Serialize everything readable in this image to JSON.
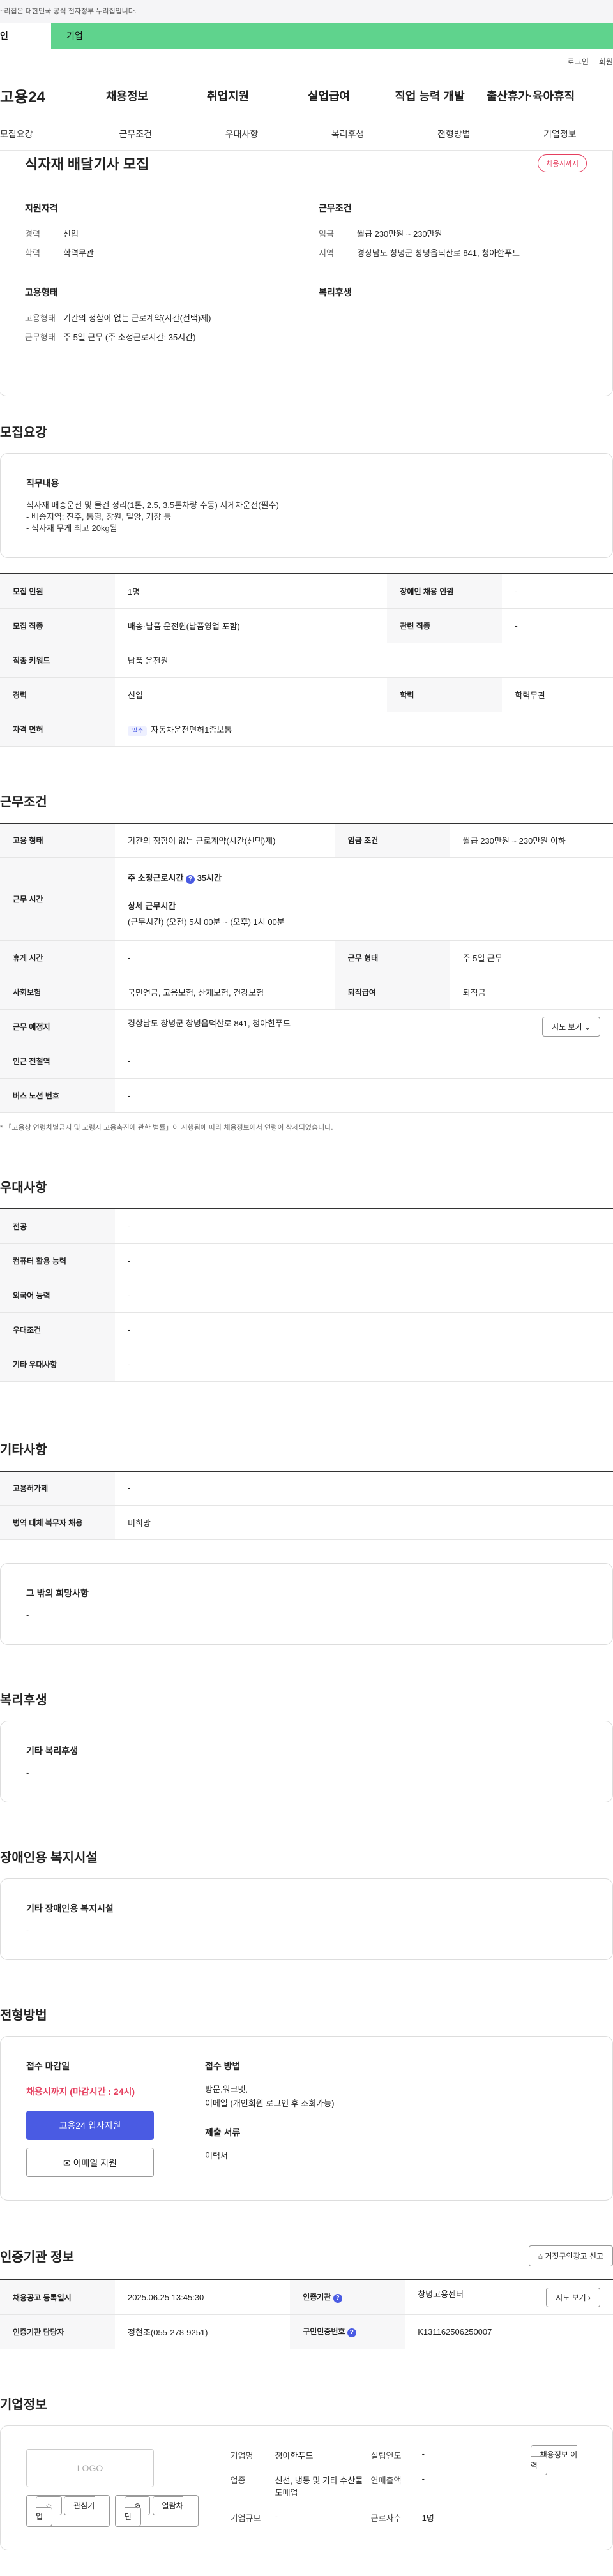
{
  "gov_notice": "~리집은 대한민국 공식 전자정부 누리집입니다.",
  "tabs": {
    "person": "인",
    "company": "기업"
  },
  "util": {
    "login": "로그인",
    "join": "회원"
  },
  "logo": "고용24",
  "gnb": [
    "채용정보",
    "취업지원",
    "실업급여",
    "직업 능력 개발",
    "출산휴가·육아휴직"
  ],
  "lnb": [
    "모집요강",
    "근무조건",
    "우대사항",
    "복리후생",
    "전형방법",
    "기업정보"
  ],
  "job": {
    "title": "식자재 배달기사 모집",
    "badge": "채용시까지",
    "qual_head": "지원자격",
    "qual": [
      {
        "k": "경력",
        "v": "신입"
      },
      {
        "k": "학력",
        "v": "학력무관"
      }
    ],
    "cond_head": "근무조건",
    "cond": [
      {
        "k": "임금",
        "v": "월급 230만원 ~ 230만원"
      },
      {
        "k": "지역",
        "v": "경상남도 창녕군 창녕읍덕산로 841, 청아한푸드"
      }
    ],
    "emp_head": "고용형태",
    "emp": [
      {
        "k": "고용형태",
        "v": "기간의 정함이 없는 근로계약(시간(선택)제)"
      },
      {
        "k": "근무형태",
        "v": "주 5일 근무 (주 소정근로시간: 35시간)"
      }
    ],
    "welfare_head": "복리후생"
  },
  "recruit": {
    "section_title": "모집요강",
    "duty_title": "직무내용",
    "duty_lines": [
      "식자재 배송운전 및 물건 정리(1톤, 2.5, 3.5톤차량 수동) 지게차운전(필수)",
      "- 배송지역: 진주, 통영, 창원, 밀양, 거창 등",
      "- 식자재 무게 최고 20kg됨"
    ],
    "rows": [
      [
        "모집 인원",
        "1명",
        "장애인 채용 인원",
        "-"
      ],
      [
        "모집 직종",
        "배송·납품 운전원(납품영업 포함)",
        "관련 직종",
        "-"
      ],
      [
        "직종 키워드",
        "납품 운전원",
        "",
        ""
      ],
      [
        "경력",
        "신입",
        "학력",
        "학력무관"
      ]
    ],
    "license_label": "자격 면허",
    "license_tag": "필수",
    "license_value": "자동차운전면허1종보통"
  },
  "work": {
    "section_title": "근무조건",
    "emp_label": "고용 형태",
    "emp_value": "기간의 정함이 없는 근로계약(시간(선택)제)",
    "wage_label": "임금 조건",
    "wage_value": "월급 230만원 ~ 230만원 이하",
    "time_label": "근무 시간",
    "weekly_label": "주 소정근로시간",
    "weekly_value": "35시간",
    "detail_label": "상세 근무시간",
    "detail_value": "(근무시간) (오전) 5시 00분 ~ (오후) 1시 00분",
    "rows": [
      [
        "휴게 시간",
        "-",
        "근무 형태",
        "주 5일 근무"
      ],
      [
        "사회보험",
        "국민연금, 고용보험, 산재보험, 건강보험",
        "퇴직급여",
        "퇴직금"
      ]
    ],
    "place_label": "근무 예정지",
    "place_value": "경상남도 창녕군 창녕읍덕산로 841, 청아한푸드",
    "map_btn": "지도 보기",
    "station_label": "인근 전철역",
    "station_value": "-",
    "bus_label": "버스 노선 번호",
    "bus_value": "-",
    "note": "* 「고용상 연령차별금지 및 고령자 고용촉진에 관한 법률」이 시행됨에 따라 채용정보에서 연령이 삭제되었습니다."
  },
  "pref": {
    "section_title": "우대사항",
    "rows": [
      [
        "전공",
        "-"
      ],
      [
        "컴퓨터 활용 능력",
        "-"
      ],
      [
        "외국어 능력",
        "-"
      ],
      [
        "우대조건",
        "-"
      ],
      [
        "기타 우대사항",
        "-"
      ]
    ]
  },
  "etc": {
    "section_title": "기타사항",
    "rows": [
      [
        "고용허가제",
        "-"
      ],
      [
        "병역 대체 복무자 채용",
        "비희망"
      ]
    ],
    "hope_title": "그 밖의 희망사항",
    "hope_value": "-"
  },
  "welfare": {
    "section_title": "복리후생",
    "box_title": "기타 복리후생",
    "box_value": "-"
  },
  "disabled": {
    "section_title": "장애인용 복지시설",
    "box_title": "기타 장애인용 복지시설",
    "box_value": "-"
  },
  "apply": {
    "section_title": "전형방법",
    "deadline_label": "접수 마감일",
    "deadline_value": "채용시까지 (마감시간 : 24시)",
    "apply_btn": "고용24 입사지원",
    "email_btn": "이메일 지원",
    "method_label": "접수 방법",
    "method_value1": "방문,워크넷,",
    "method_value2": "이메일 (개인회원 로그인 후 조회가능)",
    "docs_label": "제출 서류",
    "docs_value": "이력서"
  },
  "cert": {
    "section_title": "인증기관 정보",
    "report_btn": "거짓구인광고 신고",
    "reg_label": "채용공고 등록일시",
    "reg_value": "2025.06.25 13:45:30",
    "org_label": "인증기관",
    "org_value": "창녕고용센터",
    "map_btn": "지도 보기",
    "mgr_label": "인증기관 담당자",
    "mgr_value": "정현조(055-278-9251)",
    "no_label": "구인인증번호",
    "no_value": "K131162506250007"
  },
  "company": {
    "section_title": "기업정보",
    "logo_text": "LOGO",
    "fav_btn": "관심기업",
    "block_btn": "열람차단",
    "name_label": "기업명",
    "name_value": "청아한푸드",
    "year_label": "설립연도",
    "year_value": "-",
    "ind_label": "업종",
    "ind_value": "신선, 냉동 및 기타 수산물 도매업",
    "sales_label": "연매출액",
    "sales_value": "-",
    "emp_label": "근로자수",
    "emp_value": "1명",
    "size_label": "기업규모",
    "size_value": "-",
    "jobs_btn": "채용정보 이력"
  }
}
